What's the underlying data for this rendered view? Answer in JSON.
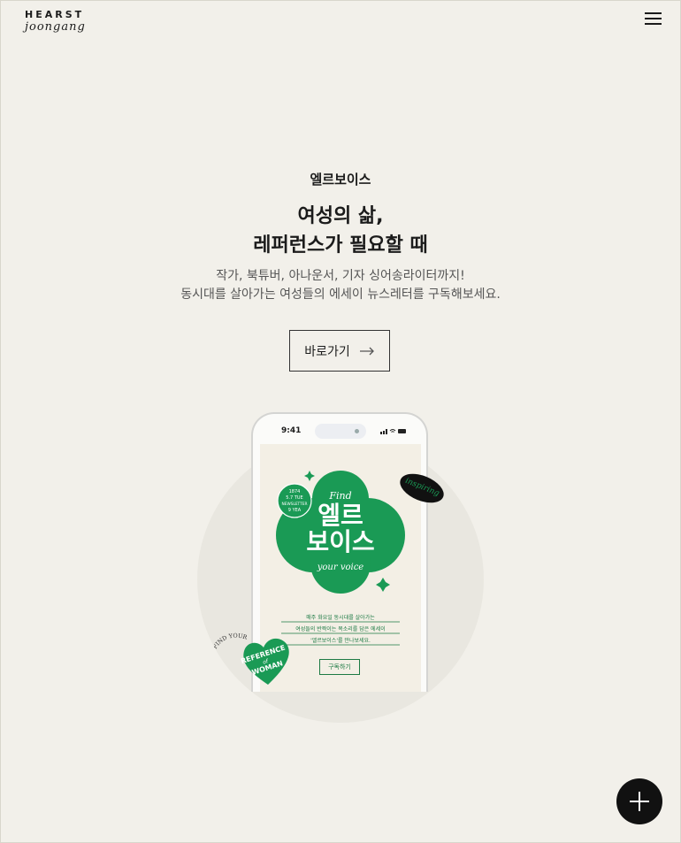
{
  "header": {
    "logo_line1": "HEARST",
    "logo_line2": "joongang",
    "menu_icon": "hamburger-menu-icon"
  },
  "hero": {
    "eyebrow": "엘르보이스",
    "headline_line1": "여성의 삶,",
    "headline_line2": "레퍼런스가 필요할 때",
    "desc_line1": "작가, 북튜버, 아나운서, 기자 싱어송라이터까지!",
    "desc_line2": "동시대를 살아가는 여성들의 에세이 뉴스레터를 구독해보세요.",
    "cta_label": "바로가기",
    "cta_icon": "arrow-right-icon"
  },
  "phone": {
    "time": "9:41",
    "badge_inspiring": "inspiring",
    "find": "Find",
    "title_line1": "엘르",
    "title_line2": "보이스",
    "your_voice": "your voice",
    "round_badge_l1": "1874",
    "round_badge_l2": "5.7 TUE",
    "round_badge_l3": "NEWSLETTER",
    "round_badge_l4": "9 YEA",
    "line1": "매주 화요일 동시대를 살아가는",
    "line2": "여성들의 반짝이는 목소리를 담은 에세이",
    "line3": "'엘르보이스'를 만나보세요.",
    "subscribe": "구독하기",
    "heart_l1": "REFERENCE",
    "heart_l2": "of",
    "heart_l3": "WOMAN",
    "arc_text": "FIND YOUR VOICE"
  },
  "fab": {
    "icon": "plus-icon"
  },
  "colors": {
    "background": "#f2f0ea",
    "green": "#1a9a55",
    "dark": "#111111"
  }
}
